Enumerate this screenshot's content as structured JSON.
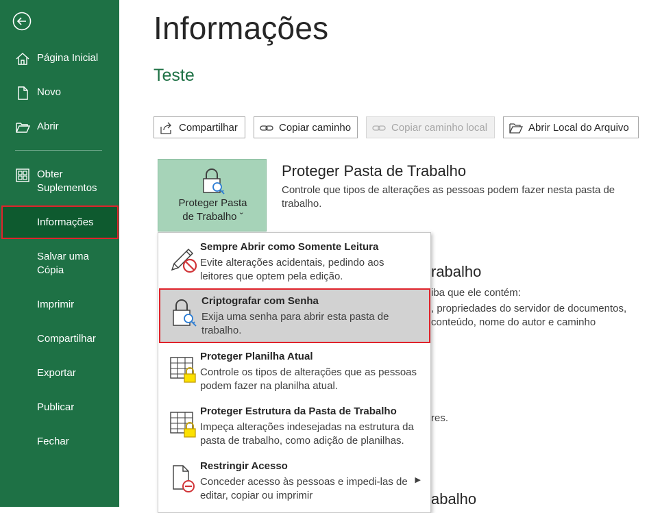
{
  "sidebar": {
    "back_icon": "back-arrow-icon",
    "items": [
      {
        "label": "Página Inicial",
        "icon": "home-icon"
      },
      {
        "label": "Novo",
        "icon": "new-document-icon"
      },
      {
        "label": "Abrir",
        "icon": "open-folder-icon"
      },
      {
        "label": "Obter\nSuplementos",
        "icon": "addins-icon"
      },
      {
        "label": "Informações"
      },
      {
        "label": "Salvar uma\nCópia"
      },
      {
        "label": "Imprimir"
      },
      {
        "label": "Compartilhar"
      },
      {
        "label": "Exportar"
      },
      {
        "label": "Publicar"
      },
      {
        "label": "Fechar"
      }
    ],
    "colors": {
      "background": "#1e7145",
      "active": "#0e5a2f"
    }
  },
  "main": {
    "title": "Informações",
    "doc_name": "Teste",
    "toolbar": [
      {
        "label": "Compartilhar",
        "icon": "share-icon"
      },
      {
        "label": "Copiar caminho",
        "icon": "link-icon"
      },
      {
        "label": "Copiar caminho local",
        "icon": "link-icon",
        "disabled": true
      },
      {
        "label": "Abrir Local do Arquivo",
        "icon": "open-folder-icon"
      }
    ],
    "protect": {
      "button_line1": "Proteger Pasta",
      "button_line2": "de Trabalho ˇ",
      "title": "Proteger Pasta de Trabalho",
      "desc": "Controle que tipos de alterações as pessoas podem fazer nesta pasta de trabalho."
    },
    "background_fragments": {
      "f1": "rabalho",
      "f2": "iba que ele contém:",
      "f3": ", propriedades do servidor de documentos,",
      "f4": "conteúdo, nome do autor e caminho",
      "f5": "res.",
      "f6": "abalho"
    }
  },
  "dropdown": {
    "items": [
      {
        "title": "Sempre Abrir como Somente Leitura",
        "desc": "Evite alterações acidentais, pedindo aos leitores que optem pela edição.",
        "icon": "pencil-no-icon"
      },
      {
        "title": "Criptografar com Senha",
        "desc": "Exija uma senha para abrir esta pasta de trabalho.",
        "icon": "lock-key-icon"
      },
      {
        "title": "Proteger Planilha Atual",
        "desc": "Controle os tipos de alterações que as pessoas podem fazer na planilha atual.",
        "icon": "sheet-lock-icon"
      },
      {
        "title": "Proteger Estrutura da Pasta de Trabalho",
        "desc": "Impeça alterações indesejadas na estrutura da pasta de trabalho, como adição de planilhas.",
        "icon": "sheet-lock-icon"
      },
      {
        "title": "Restringir Acesso",
        "desc": "Conceder acesso às pessoas e impedi-las de editar, copiar ou imprimir",
        "icon": "document-restrict-icon"
      }
    ]
  }
}
